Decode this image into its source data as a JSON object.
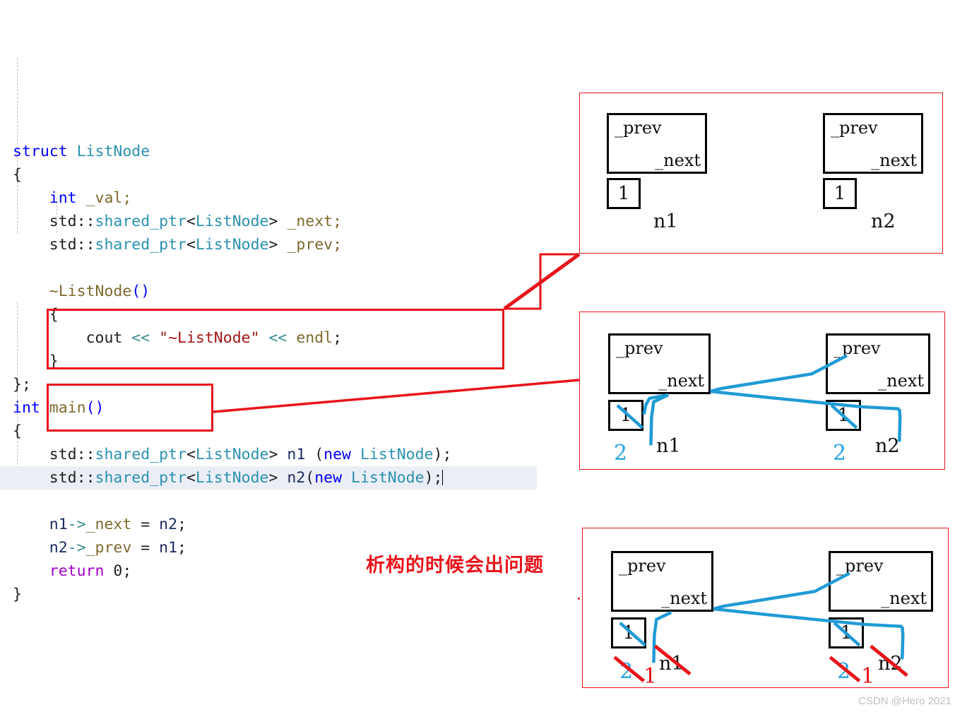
{
  "code": {
    "lines": [
      {
        "indent": 0,
        "tokens": [
          {
            "t": "struct ",
            "c": "kw"
          },
          {
            "t": "ListNode",
            "c": "type"
          }
        ]
      },
      {
        "indent": 0,
        "tokens": [
          {
            "t": "{",
            "c": "plain"
          }
        ]
      },
      {
        "indent": 1,
        "tokens": [
          {
            "t": "int ",
            "c": "kw"
          },
          {
            "t": "_val;",
            "c": "member"
          }
        ]
      },
      {
        "indent": 1,
        "tokens": [
          {
            "t": "std",
            "c": "plain"
          },
          {
            "t": "::",
            "c": "plain"
          },
          {
            "t": "shared_ptr",
            "c": "type"
          },
          {
            "t": "<",
            "c": "plain"
          },
          {
            "t": "ListNode",
            "c": "type"
          },
          {
            "t": "> ",
            "c": "plain"
          },
          {
            "t": "_next;",
            "c": "member"
          }
        ]
      },
      {
        "indent": 1,
        "tokens": [
          {
            "t": "std",
            "c": "plain"
          },
          {
            "t": "::",
            "c": "plain"
          },
          {
            "t": "shared_ptr",
            "c": "type"
          },
          {
            "t": "<",
            "c": "plain"
          },
          {
            "t": "ListNode",
            "c": "type"
          },
          {
            "t": "> ",
            "c": "plain"
          },
          {
            "t": "_prev;",
            "c": "member"
          }
        ]
      },
      {
        "indent": 1,
        "tokens": []
      },
      {
        "indent": 1,
        "tokens": [
          {
            "t": "~ListNode",
            "c": "fn"
          },
          {
            "t": "()",
            "c": "kw"
          }
        ]
      },
      {
        "indent": 1,
        "tokens": [
          {
            "t": "{",
            "c": "plain"
          }
        ]
      },
      {
        "indent": 2,
        "tokens": [
          {
            "t": "cout ",
            "c": "plain"
          },
          {
            "t": "<< ",
            "c": "op"
          },
          {
            "t": "\"~ListNode\"",
            "c": "str"
          },
          {
            "t": " << ",
            "c": "op"
          },
          {
            "t": "endl",
            "c": "fn"
          },
          {
            "t": ";",
            "c": "plain"
          }
        ]
      },
      {
        "indent": 1,
        "tokens": [
          {
            "t": "}",
            "c": "plain"
          }
        ]
      },
      {
        "indent": 0,
        "tokens": [
          {
            "t": "};",
            "c": "plain"
          }
        ]
      },
      {
        "indent": 0,
        "tokens": [
          {
            "t": "int ",
            "c": "kw"
          },
          {
            "t": "main",
            "c": "fn"
          },
          {
            "t": "()",
            "c": "kw"
          }
        ]
      },
      {
        "indent": 0,
        "tokens": [
          {
            "t": "{",
            "c": "plain"
          }
        ]
      },
      {
        "indent": 1,
        "tokens": [
          {
            "t": "std",
            "c": "plain"
          },
          {
            "t": "::",
            "c": "plain"
          },
          {
            "t": "shared_ptr",
            "c": "type"
          },
          {
            "t": "<",
            "c": "plain"
          },
          {
            "t": "ListNode",
            "c": "type"
          },
          {
            "t": "> ",
            "c": "plain"
          },
          {
            "t": "n1",
            "c": "var"
          },
          {
            "t": " (",
            "c": "plain"
          },
          {
            "t": "new ",
            "c": "kw"
          },
          {
            "t": "ListNode",
            "c": "type"
          },
          {
            "t": ");",
            "c": "plain"
          }
        ]
      },
      {
        "indent": 1,
        "highlight": true,
        "tokens": [
          {
            "t": "std",
            "c": "plain"
          },
          {
            "t": "::",
            "c": "plain"
          },
          {
            "t": "shared_ptr",
            "c": "type"
          },
          {
            "t": "<",
            "c": "plain"
          },
          {
            "t": "ListNode",
            "c": "type"
          },
          {
            "t": "> ",
            "c": "plain"
          },
          {
            "t": "n2",
            "c": "var"
          },
          {
            "t": "(",
            "c": "plain"
          },
          {
            "t": "new ",
            "c": "kw"
          },
          {
            "t": "ListNode",
            "c": "type"
          },
          {
            "t": ");",
            "c": "plain"
          },
          {
            "t": "",
            "c": "caret"
          }
        ]
      },
      {
        "indent": 1,
        "tokens": []
      },
      {
        "indent": 1,
        "tokens": [
          {
            "t": "n1",
            "c": "var"
          },
          {
            "t": "->",
            "c": "op"
          },
          {
            "t": "_next",
            "c": "member"
          },
          {
            "t": " = ",
            "c": "plain"
          },
          {
            "t": "n2",
            "c": "var"
          },
          {
            "t": ";",
            "c": "plain"
          }
        ]
      },
      {
        "indent": 1,
        "tokens": [
          {
            "t": "n2",
            "c": "var"
          },
          {
            "t": "->",
            "c": "op"
          },
          {
            "t": "_prev",
            "c": "member"
          },
          {
            "t": " = ",
            "c": "plain"
          },
          {
            "t": "n1",
            "c": "var"
          },
          {
            "t": ";",
            "c": "plain"
          }
        ]
      },
      {
        "indent": 1,
        "tokens": [
          {
            "t": "return ",
            "c": "ret"
          },
          {
            "t": "0;",
            "c": "num"
          }
        ]
      },
      {
        "indent": 0,
        "tokens": [
          {
            "t": "}",
            "c": "plain"
          }
        ]
      }
    ]
  },
  "panels": [
    {
      "id": "panel-1",
      "nodes": [
        {
          "prev_label": "_prev",
          "next_label": "_next",
          "count": "1",
          "name": "n1"
        },
        {
          "prev_label": "_prev",
          "next_label": "_next",
          "count": "1",
          "name": "n2"
        }
      ]
    },
    {
      "id": "panel-2",
      "nodes": [
        {
          "prev_label": "_prev",
          "next_label": "_next",
          "count": "1",
          "name": "n1",
          "refcount": "2"
        },
        {
          "prev_label": "_prev",
          "next_label": "_next",
          "count": "1",
          "name": "n2",
          "refcount": "2"
        }
      ]
    },
    {
      "id": "panel-3",
      "nodes": [
        {
          "prev_label": "_prev",
          "next_label": "_next",
          "count": "1",
          "name": "n1",
          "refcount": "2",
          "new_refcount": "1"
        },
        {
          "prev_label": "_prev",
          "next_label": "_next",
          "count": "1",
          "name": "n2",
          "refcount": "2",
          "new_refcount": "1"
        }
      ]
    }
  ],
  "annotation": {
    "chinese_note": "析构的时候会出问题"
  },
  "watermark": {
    "text": "CSDN @Hero 2021"
  },
  "colors": {
    "callout_red": "#e8141b",
    "pointer_blue": "#1f9bd6",
    "keyword_blue": "#0000ff",
    "type_teal": "#2b91af",
    "string_red": "#a31515",
    "member_olive": "#7d6a2e",
    "return_purple": "#9f00c8"
  }
}
